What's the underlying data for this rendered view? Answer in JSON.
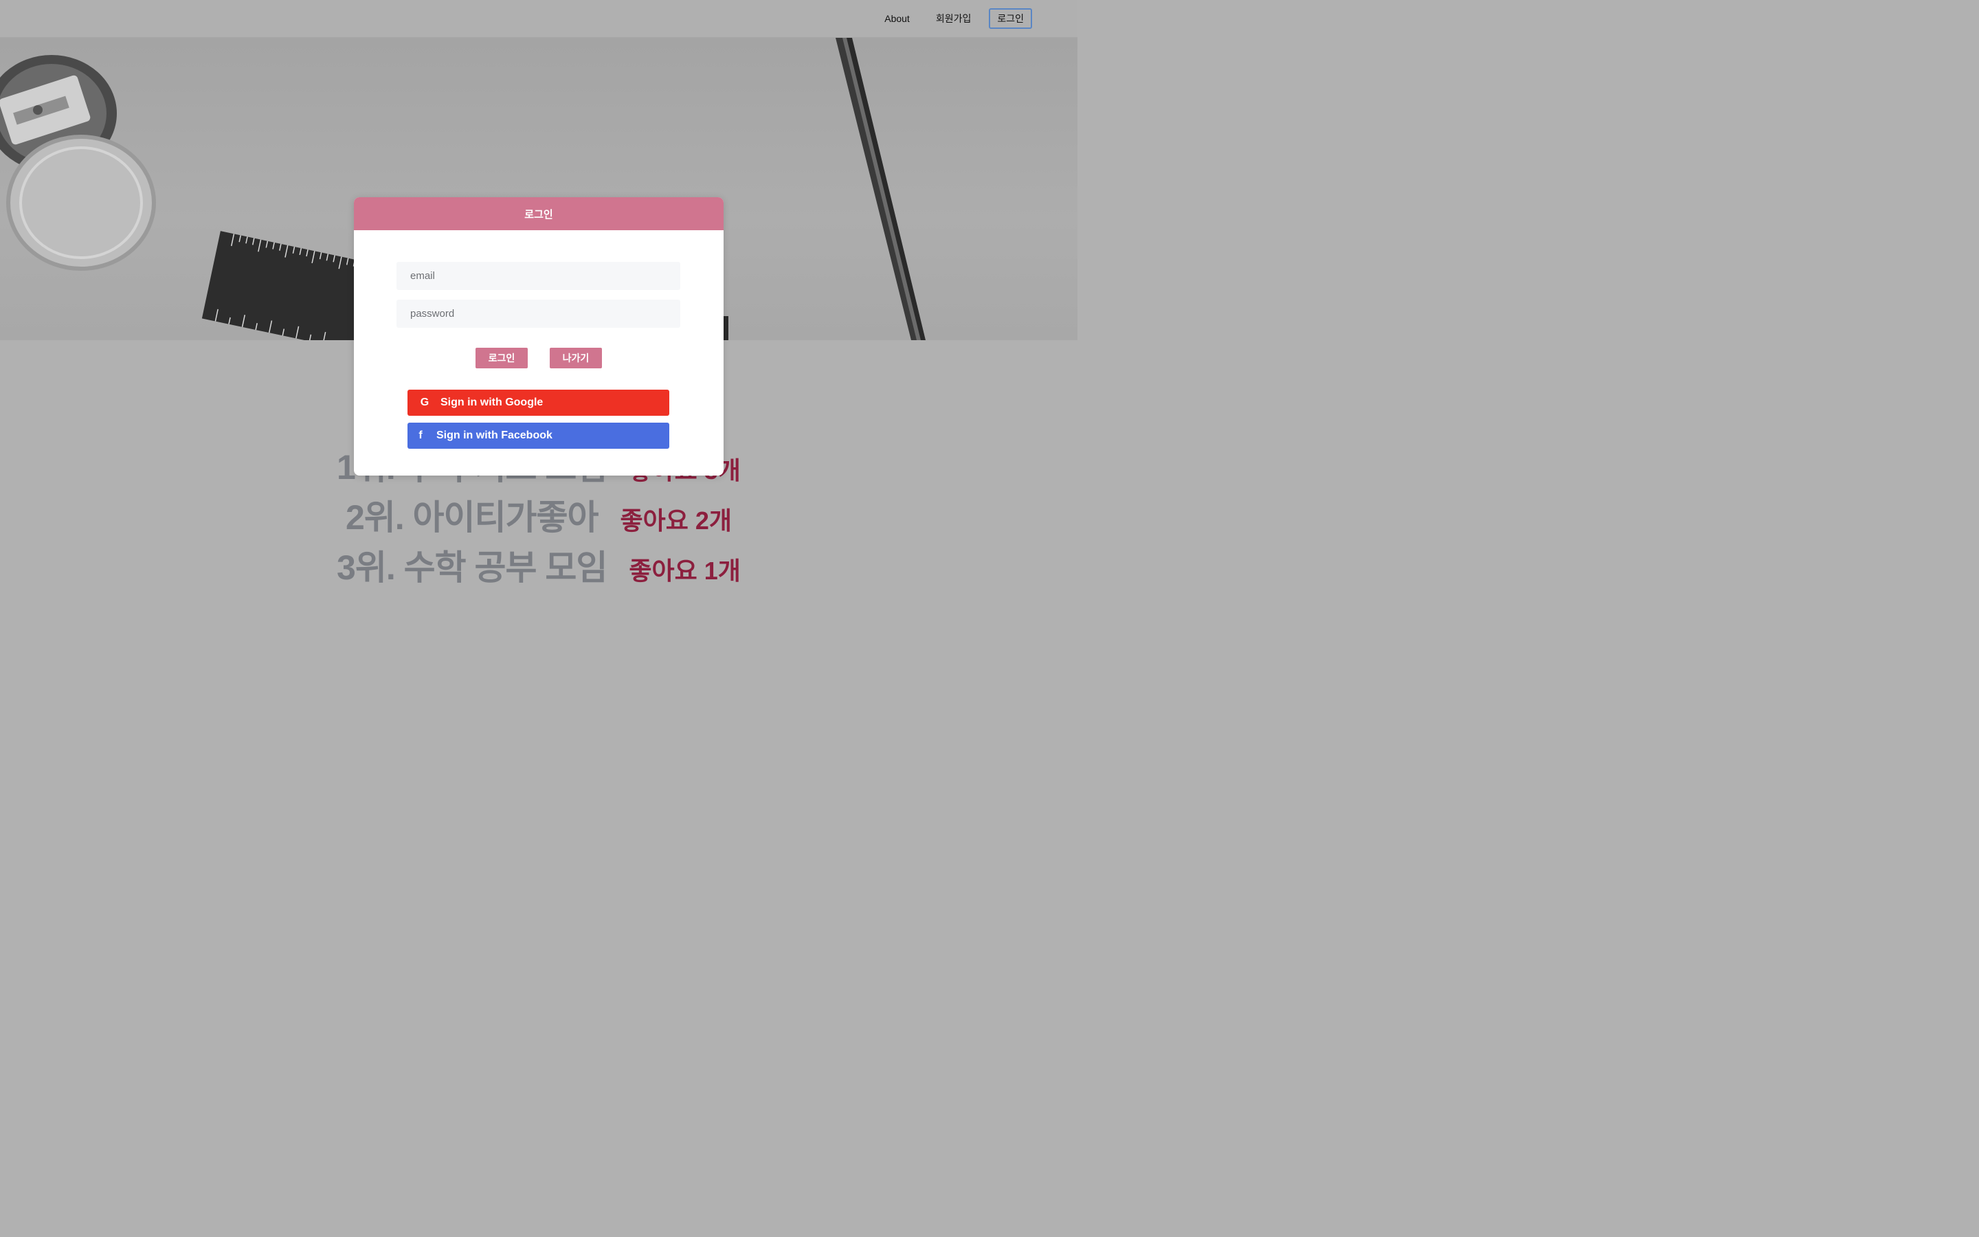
{
  "nav": {
    "items": [
      {
        "label": "About"
      },
      {
        "label": "회원가입"
      },
      {
        "label": "로그인"
      }
    ]
  },
  "ranking": [
    {
      "title": "1위. 수학 기초 모임",
      "likes": "좋아요 3개"
    },
    {
      "title": "2위. 아이티가좋아",
      "likes": "좋아요 2개"
    },
    {
      "title": "3위. 수학 공부 모임",
      "likes": "좋아요 1개"
    }
  ],
  "modal": {
    "title": "로그인",
    "email_placeholder": "email",
    "password_placeholder": "password",
    "login_button": "로그인",
    "exit_button": "나가기",
    "google_button": "Sign in with Google",
    "facebook_button": "Sign in with Facebook",
    "google_icon": "G",
    "facebook_icon": "f"
  },
  "colors": {
    "accent": "#d0758f",
    "google": "#ee3124",
    "facebook": "#4a6ee0",
    "like_text": "#8c1f3e"
  }
}
